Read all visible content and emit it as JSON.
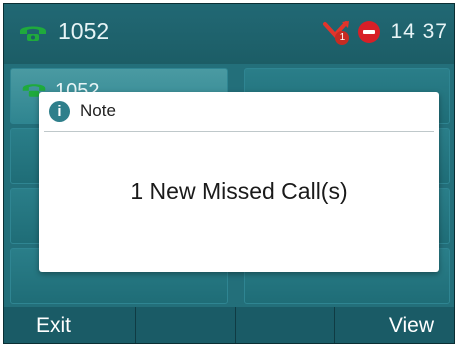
{
  "status_bar": {
    "account_number": "1052",
    "missed_count": "1",
    "clock": "14 37"
  },
  "line_keys": {
    "line1_number": "1052"
  },
  "dialog": {
    "title": "Note",
    "info_glyph": "i",
    "message": "1 New Missed Call(s)"
  },
  "softkeys": {
    "exit_label": "Exit",
    "view_label": "View"
  },
  "colors": {
    "screen_bg": "#1f6a74",
    "softkey_bg": "#1a5b66",
    "phone_icon": "#1faa3c",
    "dnd_icon": "#d81f27"
  }
}
